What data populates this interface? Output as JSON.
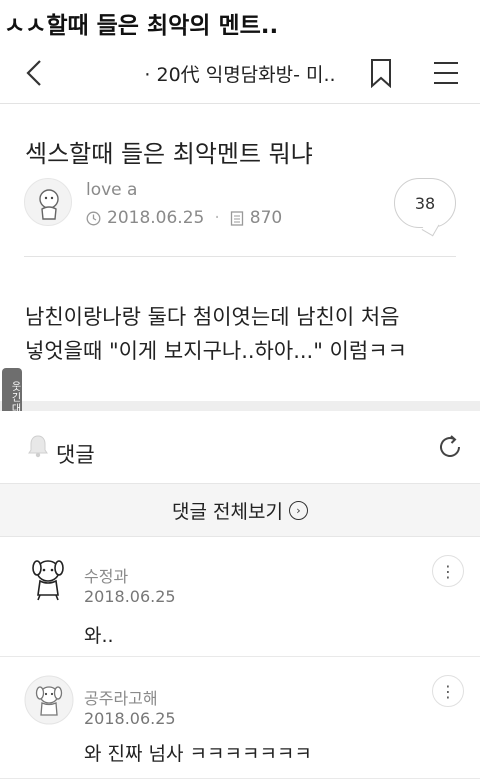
{
  "caption": "ㅅㅅ할때 들은 최악의 멘트..",
  "nav": {
    "title": "· 20代 익명담화방- 미..",
    "back_icon": "chevron-left-icon",
    "bookmark_icon": "bookmark-icon",
    "menu_icon": "hamburger-menu-icon"
  },
  "post": {
    "title": "섹스할때 들은 최악멘트 뭐냐",
    "author": "love a",
    "date": "2018.06.25",
    "views": "870",
    "comment_count": "38",
    "body_line1": "남친이랑나랑 둘다 첨이엿는데 남친이 처음",
    "body_line2": "넣엇을때 \"이게 보지구나..하아...\" 이럼ㅋㅋ"
  },
  "watermark": "웃긴대학 웃사",
  "comments_section": {
    "label": "댓글",
    "view_all": "댓글 전체보기"
  },
  "comments": [
    {
      "name": "수정과",
      "date": "2018.06.25",
      "text": "와.."
    },
    {
      "name": "공주라고해",
      "date": "2018.06.25",
      "text": "와 진짜 넘사 ㅋㅋㅋㅋㅋㅋㅋ"
    }
  ],
  "colors": {
    "text": "#222222",
    "muted": "#8a8a8a",
    "divider": "#e3e3e3",
    "band": "#eeeeee"
  }
}
